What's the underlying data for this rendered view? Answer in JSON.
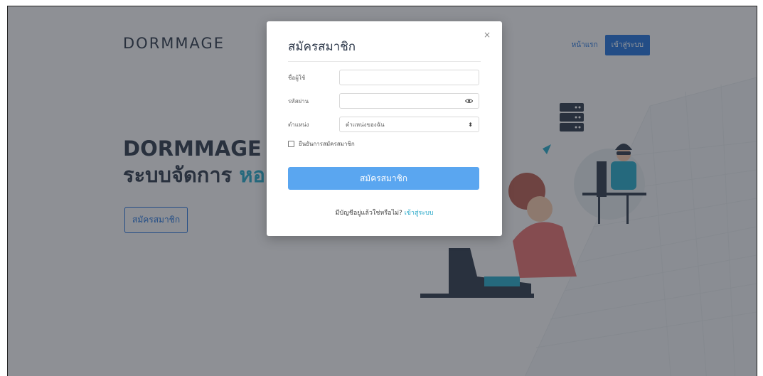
{
  "header": {
    "brand": "DORMMAGE",
    "nav_home": "หน้าแรก",
    "nav_login": "เข้าสู่ระบบ"
  },
  "hero": {
    "title": "DORMMAGE",
    "subtitle": "ระบบจัดการ",
    "subtitle_accent": "หอ",
    "cta": "สมัครสมาชิก"
  },
  "modal": {
    "title": "สมัครสมาชิก",
    "close": "×",
    "username_label": "ชื่อผู้ใช้",
    "username_value": "",
    "password_label": "รหัสผ่าน",
    "password_value": "",
    "role_label": "ตำแหน่ง",
    "role_selected": "ตำแหน่งของฉัน",
    "confirm_label": "ยืนยันการสมัครสมาชิก",
    "confirm_checked": false,
    "submit": "สมัครสมาชิก",
    "footer_text": "มีบัญชีอยู่แล้วใช่หรือไม่?",
    "footer_link": "เข้าสู่ระบบ"
  },
  "colors": {
    "primary": "#1e6fd9",
    "accent": "#22a6c7",
    "submit": "#5aa6f0",
    "overlay": "rgba(40,44,52,0.5)"
  },
  "icons": {
    "close": "close-icon",
    "eye": "eye-icon",
    "select": "select-arrow-icon"
  }
}
